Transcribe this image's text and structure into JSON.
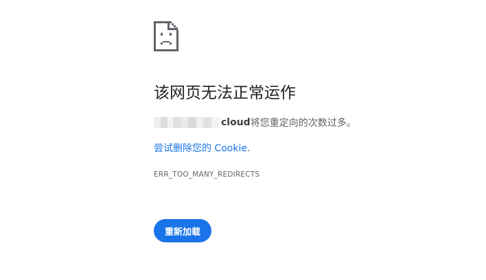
{
  "error": {
    "icon": "sad-page-icon",
    "title": "该网页无法正常运作",
    "host_suffix": "cloud",
    "description": " 将您重定向的次数过多。",
    "suggestion_link": "尝试删除您的 Cookie",
    "suggestion_period": ".",
    "error_code": "ERR_TOO_MANY_REDIRECTS",
    "reload_label": "重新加载"
  },
  "colors": {
    "accent": "#1a73e8",
    "title": "#202124",
    "secondary_text": "#5f6368"
  }
}
